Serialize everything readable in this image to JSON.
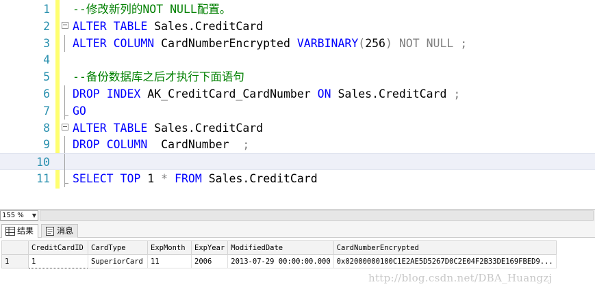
{
  "editor": {
    "lines": [
      {
        "n": "1",
        "parts": [
          [
            "cm",
            "--修改新列的NOT NULL配置。"
          ]
        ]
      },
      {
        "n": "2",
        "parts": [
          [
            "kw",
            "ALTER"
          ],
          [
            "tx",
            " "
          ],
          [
            "kw",
            "TABLE"
          ],
          [
            "tx",
            " Sales.CreditCard"
          ]
        ]
      },
      {
        "n": "3",
        "parts": [
          [
            "kw",
            "ALTER"
          ],
          [
            "tx",
            " "
          ],
          [
            "kw",
            "COLUMN"
          ],
          [
            "tx",
            " CardNumberEncrypted "
          ],
          [
            "kw",
            "VARBINARY"
          ],
          [
            "gr",
            "("
          ],
          [
            "tx",
            "256"
          ],
          [
            "gr",
            ") NOT NULL ;"
          ]
        ]
      },
      {
        "n": "4",
        "parts": []
      },
      {
        "n": "5",
        "parts": [
          [
            "cm",
            "--备份数据库之后才执行下面语句"
          ]
        ]
      },
      {
        "n": "6",
        "parts": [
          [
            "kw",
            "DROP"
          ],
          [
            "tx",
            " "
          ],
          [
            "kw",
            "INDEX"
          ],
          [
            "tx",
            " AK_CreditCard_CardNumber "
          ],
          [
            "kw",
            "ON"
          ],
          [
            "tx",
            " Sales.CreditCard "
          ],
          [
            "gr",
            ";"
          ]
        ]
      },
      {
        "n": "7",
        "parts": [
          [
            "kw",
            "GO"
          ]
        ]
      },
      {
        "n": "8",
        "parts": [
          [
            "kw",
            "ALTER"
          ],
          [
            "tx",
            " "
          ],
          [
            "kw",
            "TABLE"
          ],
          [
            "tx",
            " Sales.CreditCard"
          ]
        ]
      },
      {
        "n": "9",
        "parts": [
          [
            "kw",
            "DROP"
          ],
          [
            "tx",
            " "
          ],
          [
            "kw",
            "COLUMN"
          ],
          [
            "tx",
            "  CardNumber  "
          ],
          [
            "gr",
            ";"
          ]
        ]
      },
      {
        "n": "10",
        "parts": []
      },
      {
        "n": "11",
        "parts": [
          [
            "kw",
            "SELECT"
          ],
          [
            "tx",
            " "
          ],
          [
            "kw",
            "TOP"
          ],
          [
            "tx",
            " 1 "
          ],
          [
            "gr",
            "*"
          ],
          [
            "tx",
            " "
          ],
          [
            "kw",
            "FROM"
          ],
          [
            "tx",
            " Sales.CreditCard"
          ]
        ]
      }
    ],
    "current_line": "10"
  },
  "zoom": {
    "value": "155 %"
  },
  "tabs": [
    {
      "label": "结果",
      "active": true
    },
    {
      "label": "消息",
      "active": false
    }
  ],
  "grid": {
    "columns": [
      "CreditCardID",
      "CardType",
      "ExpMonth",
      "ExpYear",
      "ModifiedDate",
      "CardNumberEncrypted"
    ],
    "rows": [
      {
        "num": "1",
        "cells": [
          "1",
          "SuperiorCard",
          "11",
          "2006",
          "2013-07-29 00:00:00.000",
          "0x02000000100C1E2AE5D5267D0C2E04F2B33DE169FBED9..."
        ]
      }
    ]
  },
  "watermark": "http://blog.csdn.net/DBA_Huangzj",
  "colors": {
    "keyword": "#0000ff",
    "comment": "#008000",
    "line_number": "#2b91af",
    "gutter_changed": "#ffff70"
  }
}
